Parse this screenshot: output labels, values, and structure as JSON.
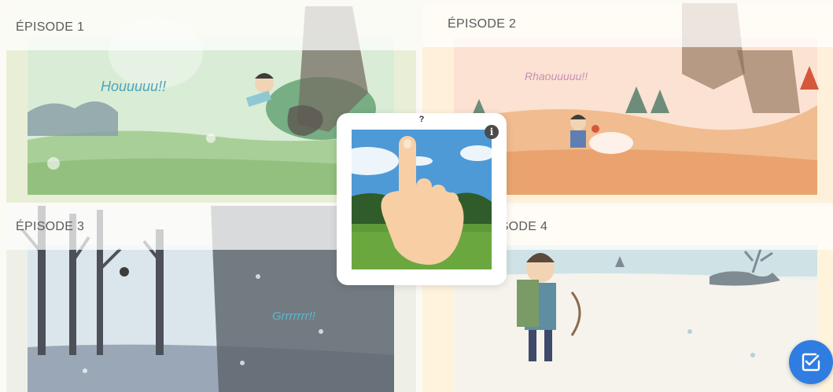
{
  "episodes": [
    {
      "label": "ÉPISODE 1",
      "sound_text": "Houuuuu!!"
    },
    {
      "label": "ÉPISODE 2",
      "sound_text": "Rhaouuuuu!!"
    },
    {
      "label": "ÉPISODE 3",
      "sound_text": "Grrrrrrr!!"
    },
    {
      "label": "ÉPISODE 4"
    }
  ],
  "popup": {
    "help_mark": "?",
    "info_icon": "info-icon",
    "image": "hand-pointing-over-lawn-photo"
  },
  "fab": {
    "icon": "checkbox-edit-icon",
    "color": "#2f7de1"
  }
}
